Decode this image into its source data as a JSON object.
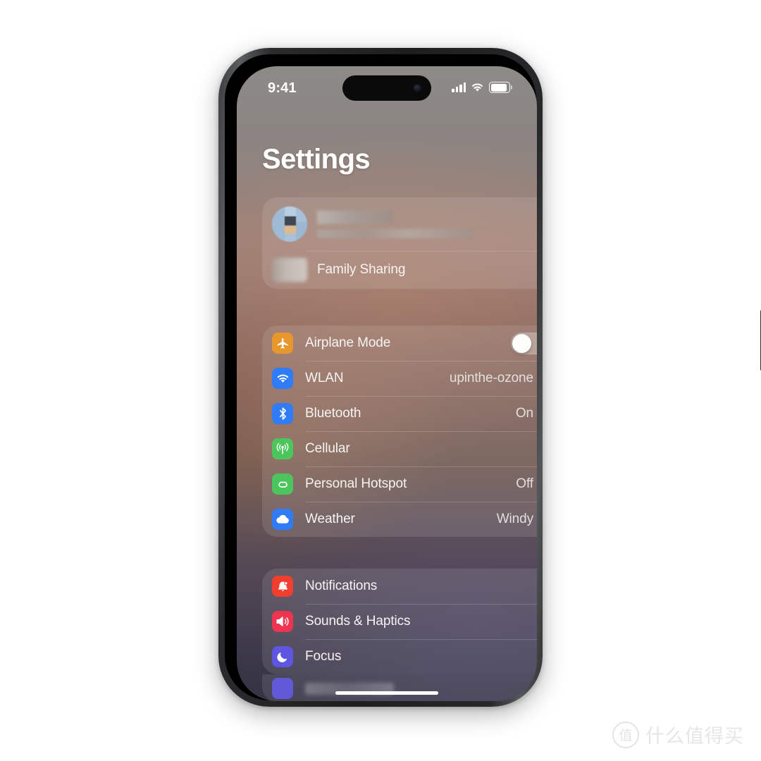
{
  "status_bar": {
    "time": "9:41",
    "signal_icon": "cellular-signal-icon",
    "wifi_icon": "wifi-icon",
    "battery_icon": "battery-full-icon"
  },
  "page_title": "Settings",
  "account_group": {
    "apple_id_row": {
      "name_redacted": "",
      "subtitle_redacted": "",
      "avatar": "user-avatar-blurred"
    },
    "family_sharing": {
      "label": "Family Sharing"
    }
  },
  "network_group": {
    "rows": [
      {
        "label": "Airplane Mode",
        "value": "",
        "icon": "airplane-icon",
        "color": "#E8962E",
        "control": "toggle",
        "toggle_on": false
      },
      {
        "label": "WLAN",
        "value": "upinthe-ozone",
        "icon": "wifi-icon",
        "color": "#2F7CF6",
        "control": "chevron"
      },
      {
        "label": "Bluetooth",
        "value": "On",
        "icon": "bluetooth-icon",
        "color": "#2F7CF6",
        "control": "chevron"
      },
      {
        "label": "Cellular",
        "value": "",
        "icon": "cellular-icon",
        "color": "#4CC65C",
        "control": "chevron"
      },
      {
        "label": "Personal Hotspot",
        "value": "Off",
        "icon": "personal-hotspot-icon",
        "color": "#4CC65C",
        "control": "chevron"
      },
      {
        "label": "Weather",
        "value": "Windy",
        "icon": "weather-cloud-icon",
        "color": "#2F7CF6",
        "control": "chevron"
      }
    ]
  },
  "system_group": {
    "rows": [
      {
        "label": "Notifications",
        "value": "",
        "icon": "bell-icon",
        "color": "#F03E2F",
        "control": "chevron"
      },
      {
        "label": "Sounds & Haptics",
        "value": "",
        "icon": "speaker-icon",
        "color": "#ED3551",
        "control": "chevron"
      },
      {
        "label": "Focus",
        "value": "",
        "icon": "moon-icon",
        "color": "#5E55E0",
        "control": "chevron"
      }
    ],
    "partial_row": {
      "label_redacted": "",
      "icon": "hourglass-icon",
      "color": "#6159D6"
    }
  },
  "home_indicator": "home-indicator-bar",
  "watermark": {
    "logo_char": "值",
    "text": "什么值得买"
  },
  "theme": {
    "accent_blue": "#2F7CF6",
    "accent_green": "#4CC65C",
    "accent_orange": "#E8962E",
    "accent_red": "#F03E2F",
    "accent_pink_red": "#ED3551",
    "accent_purple": "#5E55E0"
  }
}
